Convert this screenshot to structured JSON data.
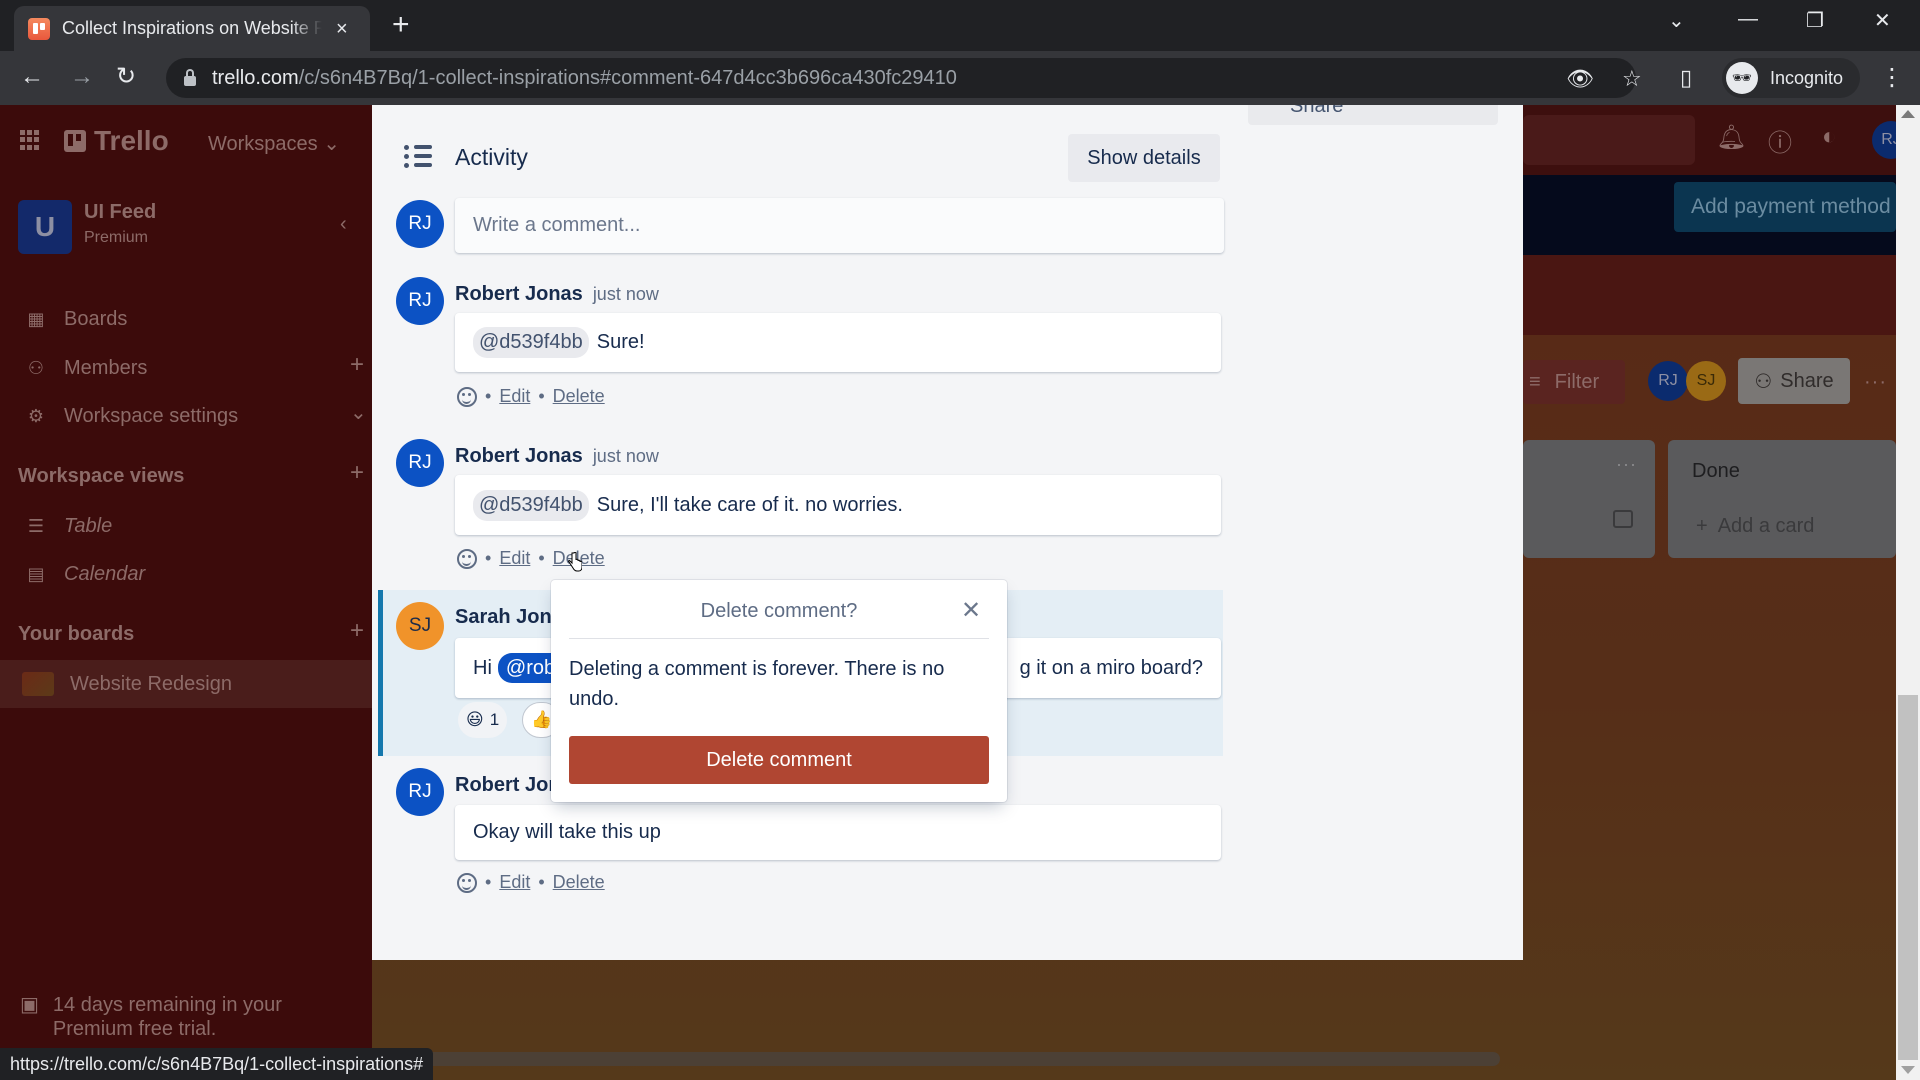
{
  "browser": {
    "tab_title": "Collect Inspirations on Website Redesign",
    "tab_close": "×",
    "new_tab": "+",
    "url_host": "trello.com",
    "url_path": "/c/s6n4B7Bq/1-collect-inspirations#comment-647d4cc3b696ca430fc29410",
    "profile_label": "Incognito",
    "status_url": "https://trello.com/c/s6n4B7Bq/1-collect-inspirations#"
  },
  "topnav": {
    "logo": "Trello",
    "workspaces_label": "Workspaces",
    "avatar_initials": "RJ"
  },
  "sidebar": {
    "workspace_initial": "U",
    "workspace_name": "UI Feed",
    "workspace_plan": "Premium",
    "items": [
      {
        "label": "Boards",
        "icon": "board-icon"
      },
      {
        "label": "Members",
        "icon": "person-icon"
      },
      {
        "label": "Workspace settings",
        "icon": "gear-icon"
      }
    ],
    "views_heading": "Workspace views",
    "views": [
      {
        "label": "Table",
        "icon": "table-icon"
      },
      {
        "label": "Calendar",
        "icon": "calendar-icon"
      }
    ],
    "boards_heading": "Your boards",
    "boards": [
      {
        "label": "Website Redesign"
      }
    ],
    "trial_text_line1": "14 days remaining in your",
    "trial_text_line2": "Premium free trial."
  },
  "board": {
    "payment_button": "Add payment method",
    "filter_label": "Filter",
    "members": [
      "RJ",
      "SJ"
    ],
    "share_label": "Share",
    "lists": [
      {
        "title": "",
        "more": "···"
      },
      {
        "title": "Done",
        "add_card": "Add a card"
      }
    ]
  },
  "card": {
    "share_partial": "Share",
    "activity_title": "Activity",
    "show_details_label": "Show details",
    "current_user_initials": "RJ",
    "comment_placeholder": "Write a comment...",
    "comments": [
      {
        "initials": "RJ",
        "author": "Robert Jonas",
        "time": "just now",
        "mention": "@d539f4bb",
        "text": "Sure!",
        "edit": "Edit",
        "delete": "Delete"
      },
      {
        "initials": "RJ",
        "author": "Robert Jonas",
        "time": "just now",
        "mention": "@d539f4bb",
        "text": "Sure, I'll take care of it. no worries.",
        "edit": "Edit",
        "delete": "Delete"
      },
      {
        "initials": "SJ",
        "author": "Sarah Jones",
        "text_prefix": "Hi",
        "mention": "@robert",
        "text_suffix": "g it on a miro board?",
        "reactions": [
          {
            "emoji": "😃",
            "count": "1"
          },
          {
            "emoji": "👍",
            "count": ""
          }
        ]
      },
      {
        "initials": "RJ",
        "author": "Robert Jonas",
        "text": "Okay will take this up",
        "edit": "Edit",
        "delete": "Delete"
      }
    ],
    "separator": "•"
  },
  "delete_popover": {
    "title": "Delete comment?",
    "body": "Deleting a comment is forever. There is no undo.",
    "confirm_label": "Delete comment",
    "confirm_color": "#b04632"
  }
}
